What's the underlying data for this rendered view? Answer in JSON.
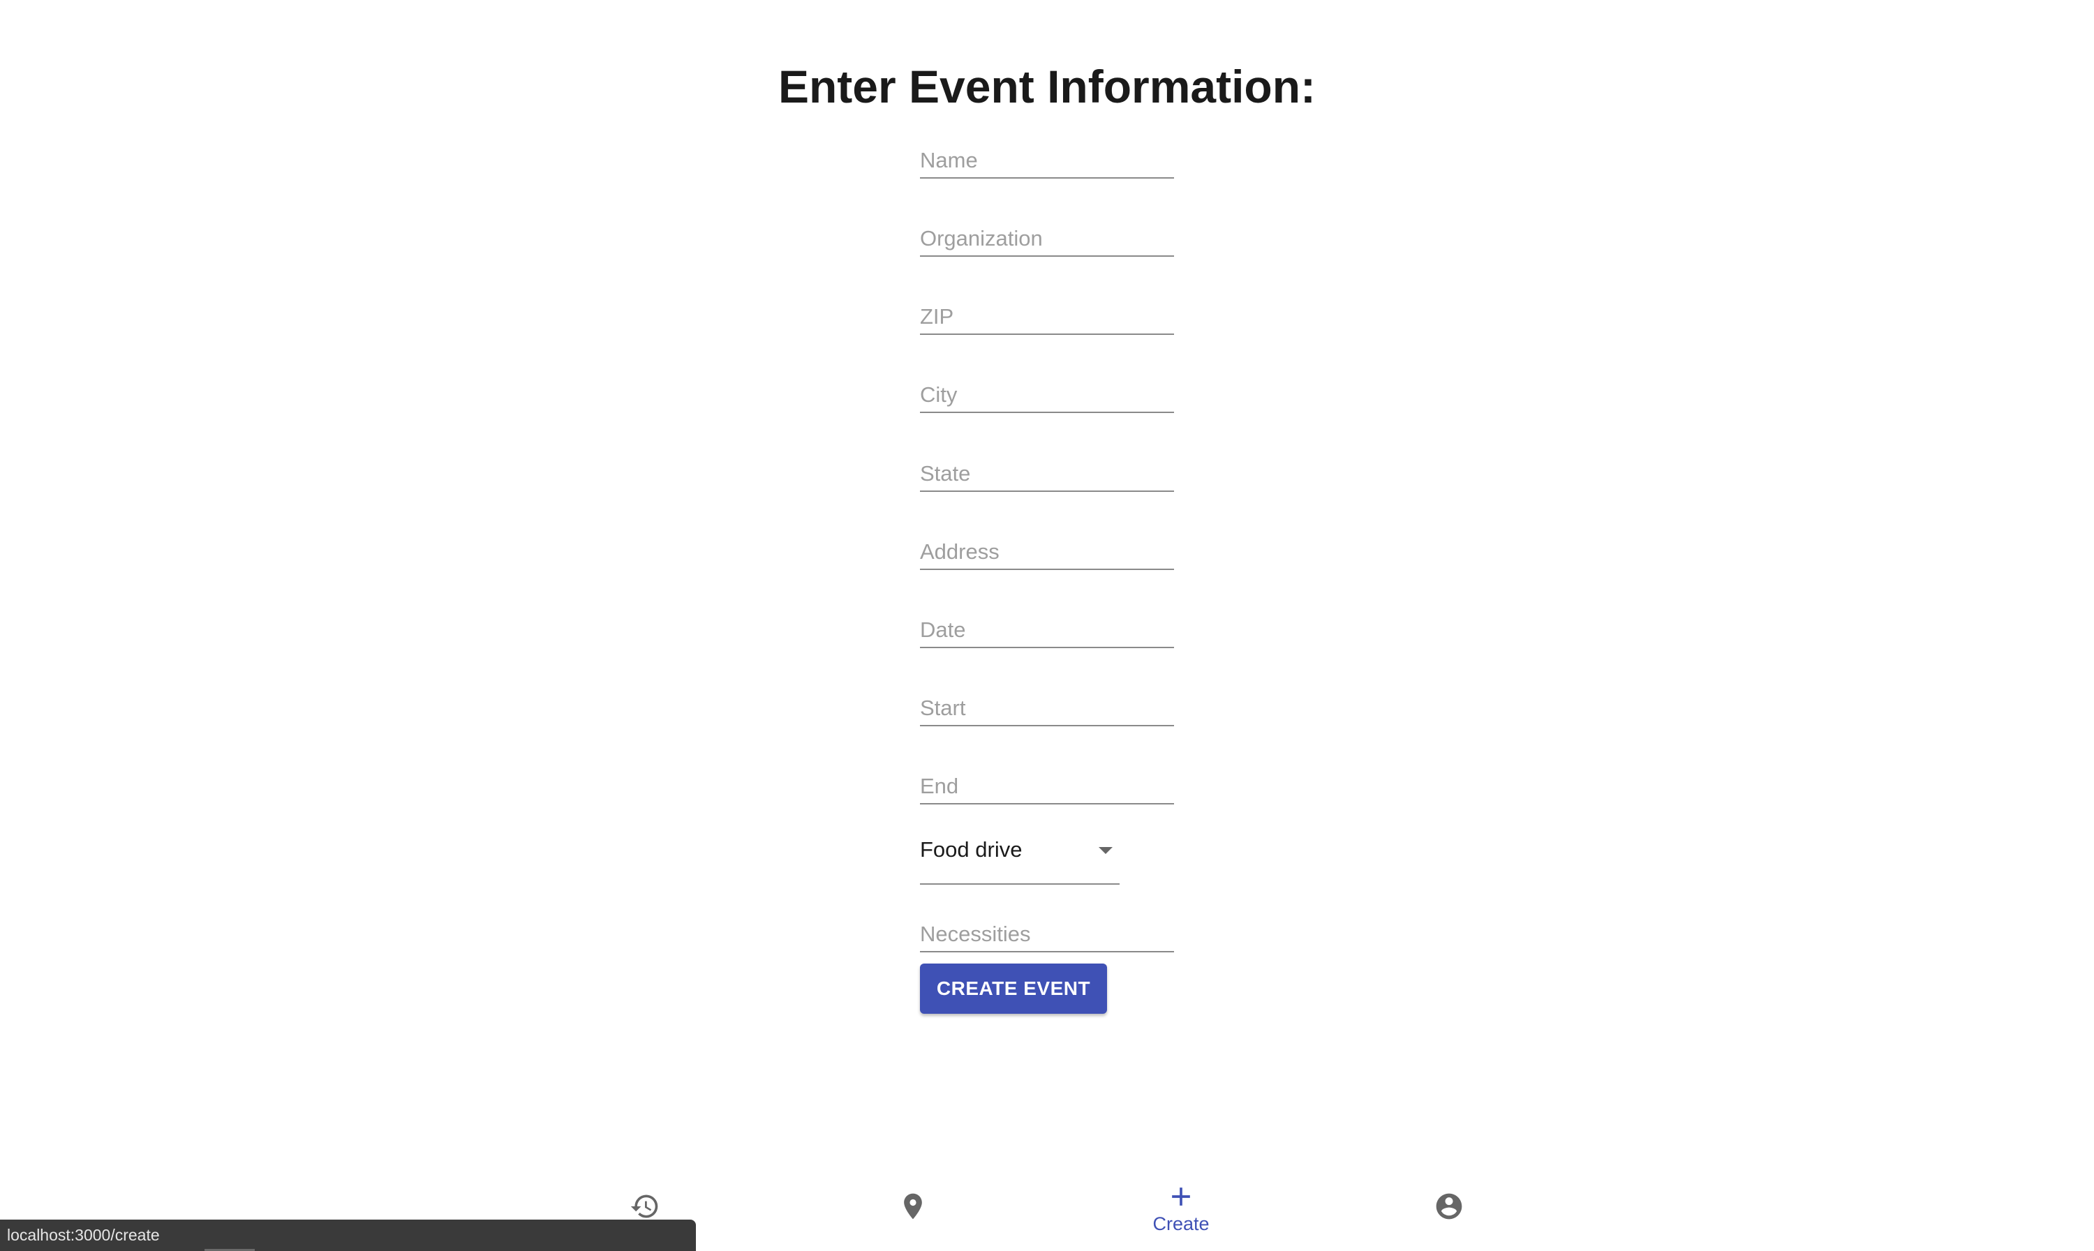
{
  "page": {
    "title": "Enter Event Information:"
  },
  "form": {
    "fields": [
      {
        "placeholder": "Name",
        "value": ""
      },
      {
        "placeholder": "Organization",
        "value": ""
      },
      {
        "placeholder": "ZIP",
        "value": ""
      },
      {
        "placeholder": "City",
        "value": ""
      },
      {
        "placeholder": "State",
        "value": ""
      },
      {
        "placeholder": "Address",
        "value": ""
      },
      {
        "placeholder": "Date",
        "value": ""
      },
      {
        "placeholder": "Start",
        "value": ""
      },
      {
        "placeholder": "End",
        "value": ""
      }
    ],
    "event_type": {
      "selected": "Food drive"
    },
    "necessities": {
      "placeholder": "Necessities",
      "value": ""
    },
    "submit_label": "CREATE EVENT"
  },
  "bottom_nav": {
    "items": [
      {
        "icon": "history-icon",
        "label": ""
      },
      {
        "icon": "location-pin-icon",
        "label": ""
      },
      {
        "icon": "plus-icon",
        "label": "Create",
        "active": true
      },
      {
        "icon": "account-circle-icon",
        "label": ""
      }
    ]
  },
  "status_bar": {
    "url": "localhost:3000/create"
  },
  "colors": {
    "primary": "#3f51b5",
    "text": "#1a1a1a",
    "placeholder": "#9e9e9e",
    "icon_inactive": "#666666",
    "status_bar_bg": "#3a3a3a"
  }
}
